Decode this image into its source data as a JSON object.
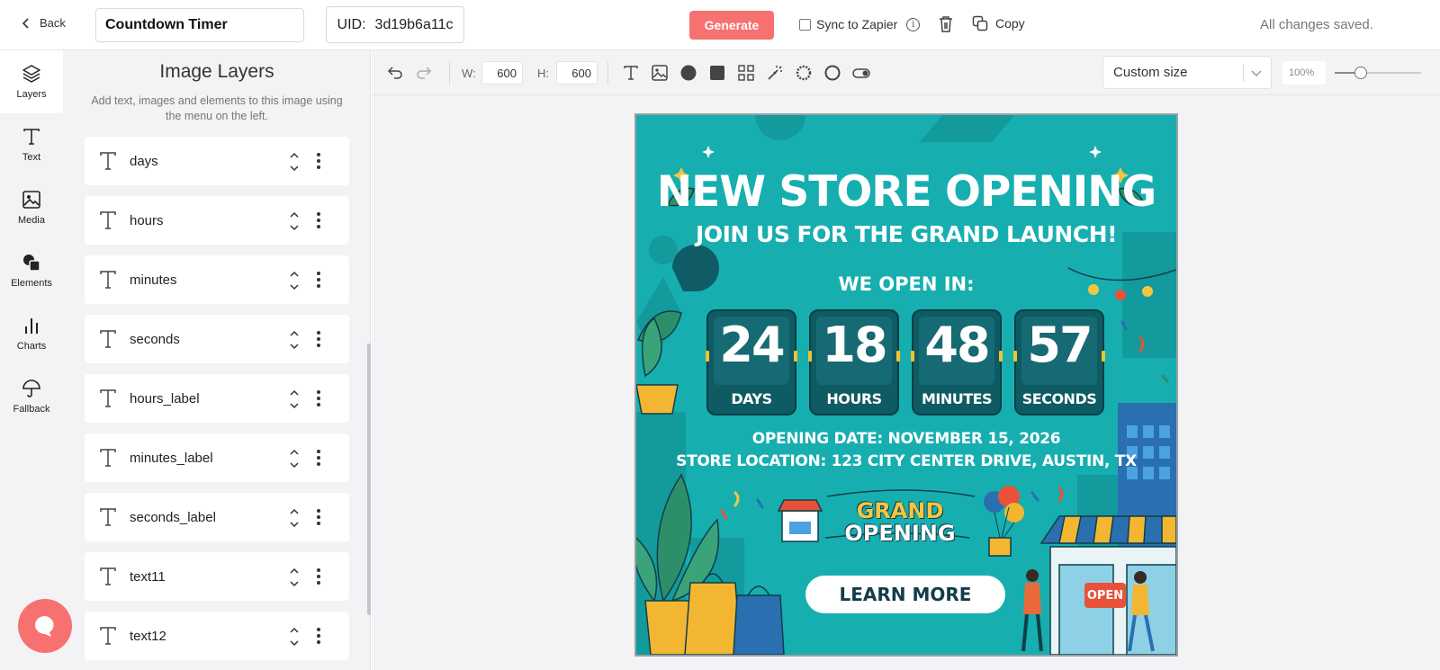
{
  "topbar": {
    "back_label": "Back",
    "title_value": "Countdown Timer",
    "uid_label": "UID:",
    "uid_value": "3d19b6a11c",
    "generate_label": "Generate",
    "sync_label": "Sync to Zapier",
    "copy_label": "Copy",
    "status": "All changes saved."
  },
  "rail": {
    "items": [
      {
        "label": "Layers",
        "icon": "layers-icon"
      },
      {
        "label": "Text",
        "icon": "text-icon"
      },
      {
        "label": "Media",
        "icon": "image-icon"
      },
      {
        "label": "Elements",
        "icon": "shapes-icon"
      },
      {
        "label": "Charts",
        "icon": "bar-chart-icon"
      },
      {
        "label": "Fallback",
        "icon": "umbrella-icon"
      }
    ]
  },
  "panel": {
    "title": "Image Layers",
    "description": "Add text, images and elements to this image using the menu on the left.",
    "layers": [
      {
        "name": "days"
      },
      {
        "name": "hours"
      },
      {
        "name": "minutes"
      },
      {
        "name": "seconds"
      },
      {
        "name": "hours_label"
      },
      {
        "name": "minutes_label"
      },
      {
        "name": "seconds_label"
      },
      {
        "name": "text11"
      },
      {
        "name": "text12"
      }
    ]
  },
  "toolbar": {
    "width_label": "W:",
    "width_value": "600",
    "height_label": "H:",
    "height_value": "600",
    "size_preset": "Custom size",
    "zoom_value": "100%",
    "zoom_fraction": 0.3
  },
  "artwork": {
    "headline": "NEW STORE OPENING",
    "subheadline": "JOIN US FOR THE GRAND LAUNCH!",
    "open_in": "WE OPEN IN:",
    "countdown": [
      {
        "value": "24",
        "label": "DAYS"
      },
      {
        "value": "18",
        "label": "HOURS"
      },
      {
        "value": "48",
        "label": "MINUTES"
      },
      {
        "value": "57",
        "label": "SECONDS"
      }
    ],
    "opening_date": "OPENING DATE: NOVEMBER 15, 2026",
    "store_location": "STORE LOCATION: 123 CITY CENTER DRIVE, AUSTIN, TX",
    "banner_line1": "GRAND",
    "banner_line2": "OPENING",
    "cta": "LEARN MORE",
    "sign": "OPEN",
    "colors": {
      "background": "#17aeb0",
      "card": "#0e5b64",
      "accent": "#f2c230",
      "cta_text": "#123c48",
      "generate": "#f87171"
    }
  }
}
